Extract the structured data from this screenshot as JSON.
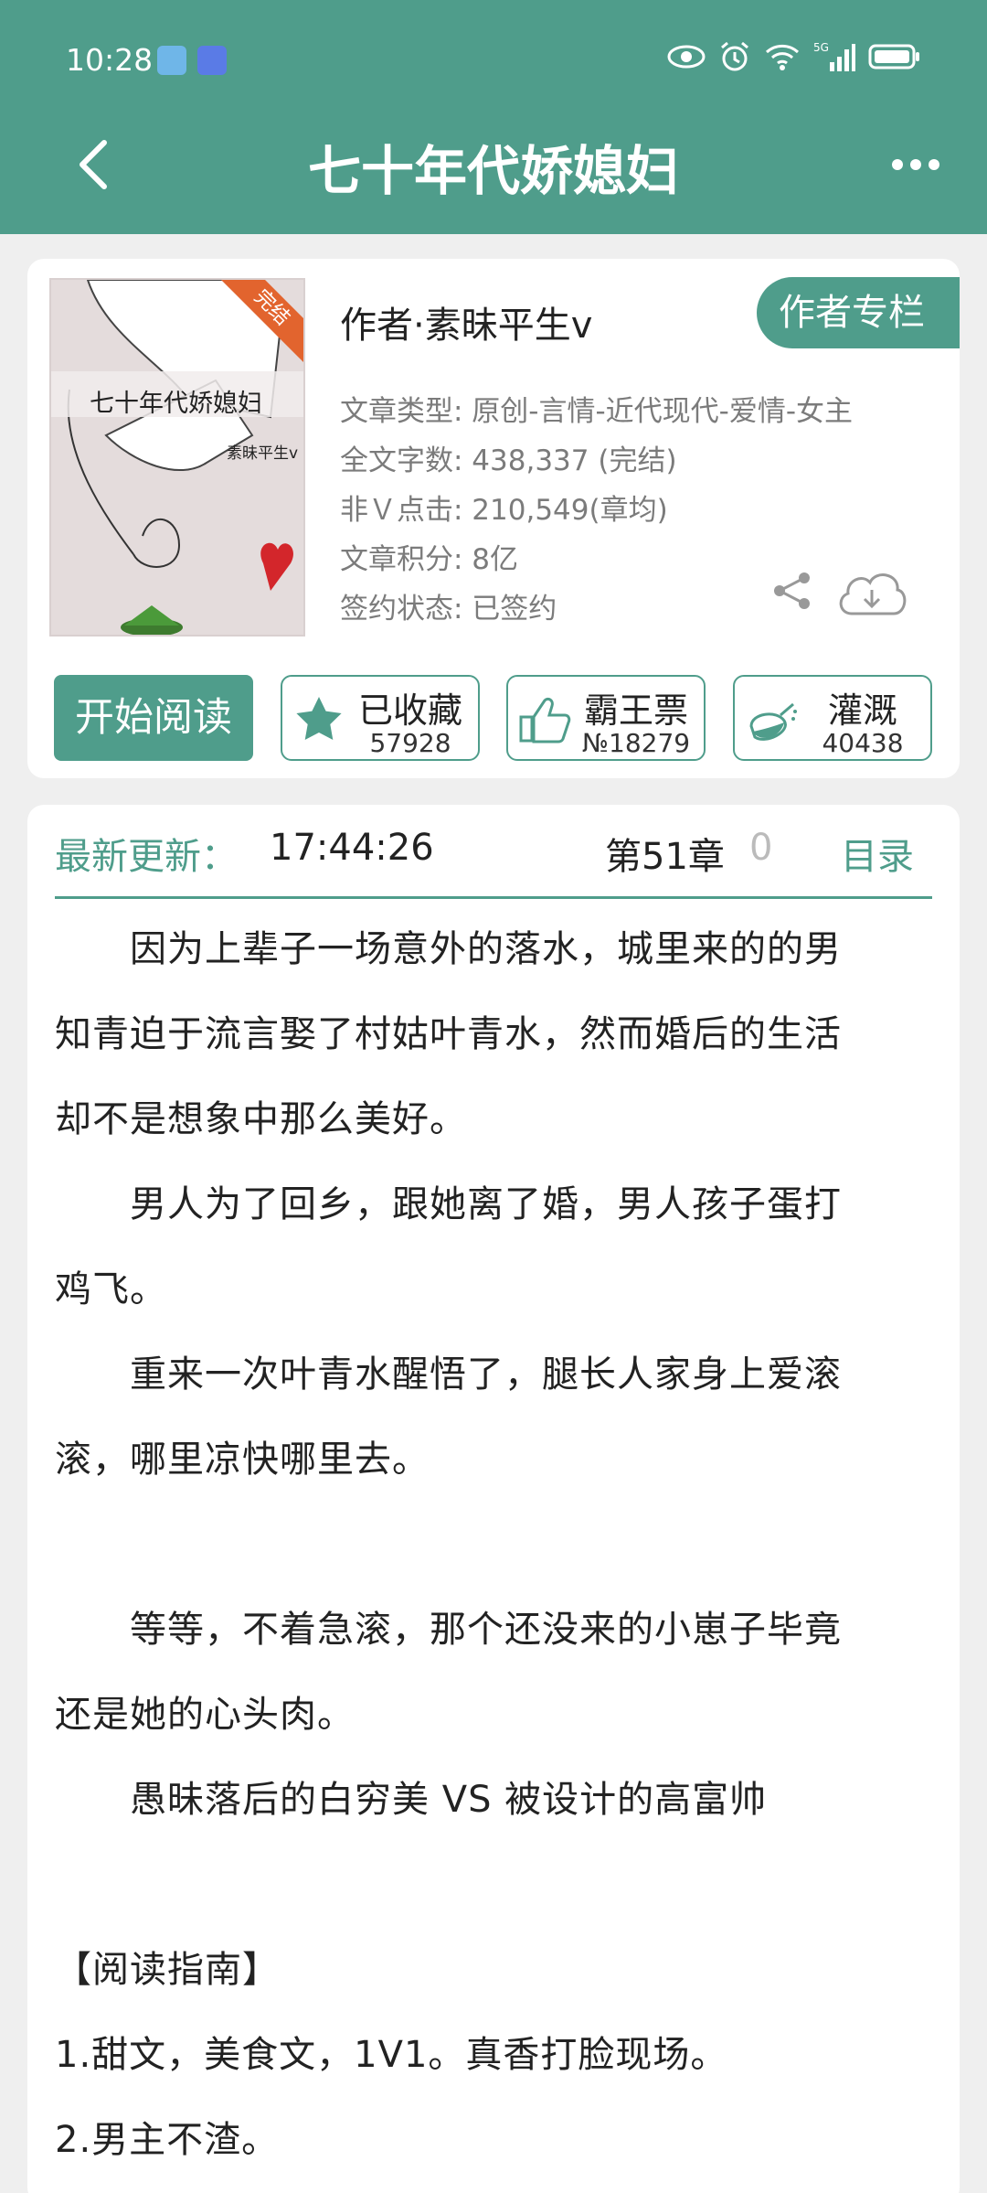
{
  "status_bar": {
    "time": "10:28",
    "network": "5G"
  },
  "header": {
    "title": "七十年代娇媳妇"
  },
  "book": {
    "cover_title": "七十年代娇媳妇",
    "cover_author": "素昧平生v",
    "cover_ribbon": "完结",
    "author": "作者·素昧平生v",
    "author_column_label": "作者专栏",
    "meta": {
      "type": "文章类型: 原创-言情-近代现代-爱情-女主",
      "words": "全文字数: 438,337 (完结)",
      "clicks": "非Ｖ点击: 210,549(章均)",
      "points": "文章积分: 8亿",
      "contract": "签约状态: 已签约"
    },
    "actions": {
      "read": "开始阅读",
      "collect_label": "已收藏",
      "collect_count": "57928",
      "ticket_label": "霸王票",
      "ticket_count": "№18279",
      "water_label": "灌溉",
      "water_count": "40438"
    }
  },
  "latest": {
    "label": "最新更新：",
    "time": "17:44:26",
    "chapter": "第51章",
    "chapter_suffix": "0",
    "catalog": "目录"
  },
  "intro": {
    "paragraphs": [
      "　　因为上辈子一场意外的落水，城里来的的男",
      "知青迫于流言娶了村姑叶青水，然而婚后的生活",
      "却不是想象中那么美好。",
      "　　男人为了回乡，跟她离了婚，男人孩子蛋打",
      "鸡飞。",
      "　　重来一次叶青水醒悟了，腿长人家身上爱滚",
      "滚，哪里凉快哪里去。",
      "",
      "　　等等，不着急滚，那个还没来的小崽子毕竟",
      "还是她的心头肉。",
      "　　愚昧落后的白穷美 VS 被设计的高富帅",
      "",
      "【阅读指南】",
      "1.甜文，美食文，1V1。真香打脸现场。",
      "2.男主不渣。"
    ]
  },
  "colors": {
    "accent": "#4f9d8b",
    "ribbon": "#e2642e"
  }
}
